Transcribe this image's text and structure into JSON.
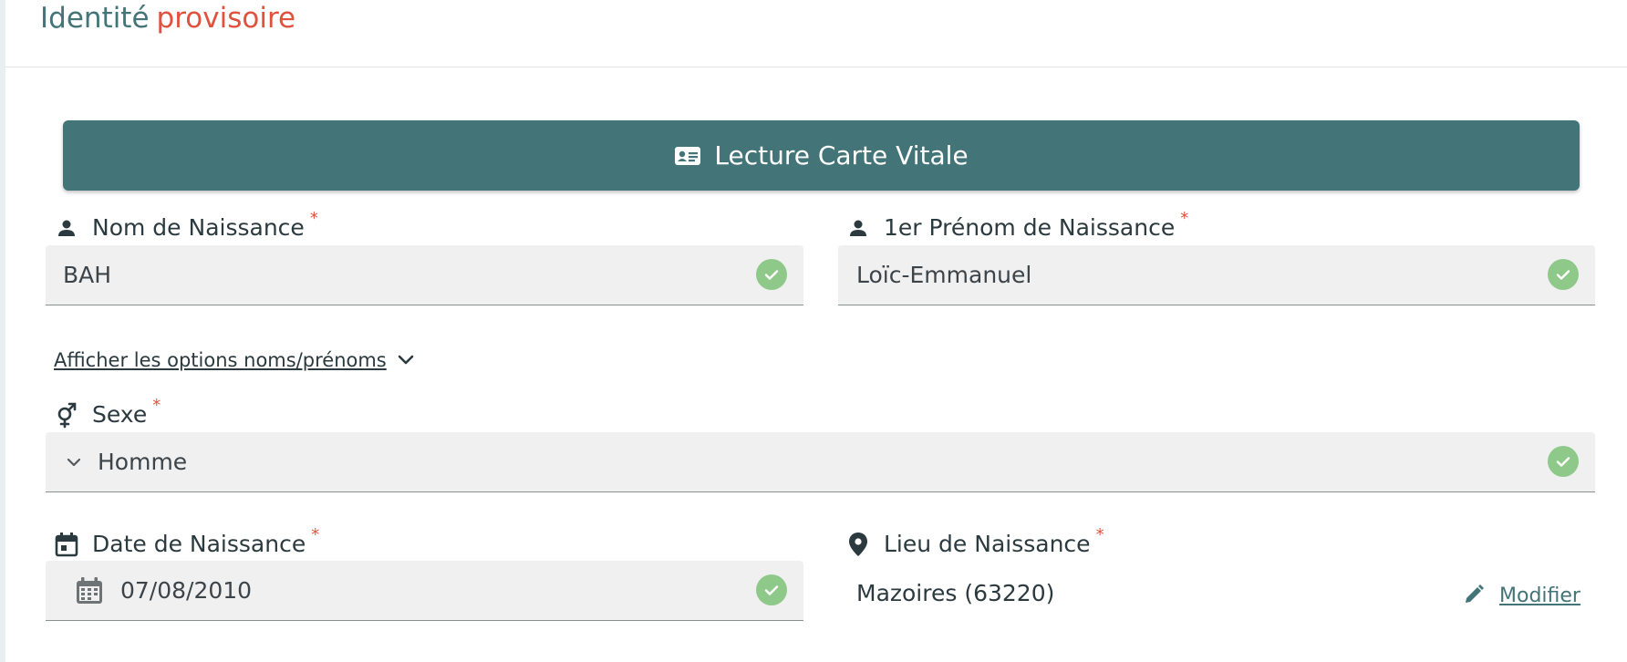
{
  "header": {
    "title_part1": "Identité",
    "title_part2": "provisoire"
  },
  "vitale_button": {
    "label": "Lecture Carte Vitale",
    "icon": "id-card-icon"
  },
  "required_marker": "*",
  "fields": {
    "nom": {
      "label": "Nom de Naissance",
      "value": "BAH",
      "icon": "person-icon"
    },
    "prenom": {
      "label": "1er Prénom de Naissance",
      "value": "Loïc-Emmanuel",
      "icon": "person-icon"
    },
    "sexe": {
      "label": "Sexe",
      "value": "Homme",
      "icon": "gender-icon"
    },
    "date": {
      "label": "Date de Naissance",
      "value": "07/08/2010",
      "icon": "calendar-icon"
    },
    "lieu": {
      "label": "Lieu de Naissance",
      "value": "Mazoires (63220)",
      "icon": "location-pin-icon"
    }
  },
  "options_link": {
    "label": "Afficher les options noms/prénoms"
  },
  "modifier_link": {
    "label": "Modifier"
  },
  "colors": {
    "primary": "#437477",
    "accent": "#e0523e",
    "valid": "#8fc98a",
    "field_bg": "#f0f0f0"
  }
}
